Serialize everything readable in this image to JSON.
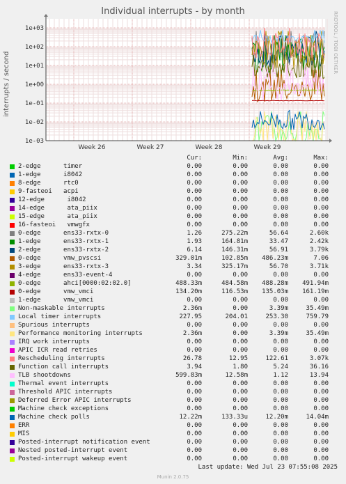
{
  "chart_data": {
    "type": "line",
    "title": "Individual interrupts - by month",
    "ylabel": "interrupts / second",
    "yscale": "log",
    "ylim": [
      0.001,
      1000
    ],
    "y_ticks": [
      "1e+03",
      "1e+02",
      "1e+01",
      "1e+00",
      "1e-01",
      "1e-02",
      "1e-03"
    ],
    "x_ticks": [
      "Week 26",
      "Week 27",
      "Week 28",
      "Week 29"
    ],
    "grid": true,
    "side_label": "RRDTOOL / TOBI OETIKER",
    "columns": [
      "Cur:",
      "Min:",
      "Avg:",
      "Max:"
    ],
    "series": [
      {
        "name": "2-edge      timer",
        "color": "#00cc00",
        "cur": "0.00",
        "min": "0.00",
        "avg": "0.00",
        "max": "0.00"
      },
      {
        "name": "1-edge      i8042",
        "color": "#0066b3",
        "cur": "0.00",
        "min": "0.00",
        "avg": "0.00",
        "max": "0.00"
      },
      {
        "name": "8-edge      rtc0",
        "color": "#ff8000",
        "cur": "0.00",
        "min": "0.00",
        "avg": "0.00",
        "max": "0.00"
      },
      {
        "name": "9-fasteoi   acpi",
        "color": "#ffcc00",
        "cur": "0.00",
        "min": "0.00",
        "avg": "0.00",
        "max": "0.00"
      },
      {
        "name": "12-edge      i8042",
        "color": "#330099",
        "cur": "0.00",
        "min": "0.00",
        "avg": "0.00",
        "max": "0.00"
      },
      {
        "name": "14-edge      ata_piix",
        "color": "#990099",
        "cur": "0.00",
        "min": "0.00",
        "avg": "0.00",
        "max": "0.00"
      },
      {
        "name": "15-edge      ata_piix",
        "color": "#ccff00",
        "cur": "0.00",
        "min": "0.00",
        "avg": "0.00",
        "max": "0.00"
      },
      {
        "name": "16-fasteoi   vmwgfx",
        "color": "#ff0000",
        "cur": "0.00",
        "min": "0.00",
        "avg": "0.00",
        "max": "0.00"
      },
      {
        "name": "0-edge      ens33-rxtx-0",
        "color": "#808080",
        "cur": "1.26",
        "min": "275.22m",
        "avg": "56.64",
        "max": "2.60k"
      },
      {
        "name": "1-edge      ens33-rxtx-1",
        "color": "#008f00",
        "cur": "1.93",
        "min": "164.81m",
        "avg": "33.47",
        "max": "2.42k"
      },
      {
        "name": "2-edge      ens33-rxtx-2",
        "color": "#00487d",
        "cur": "6.14",
        "min": "146.31m",
        "avg": "56.91",
        "max": "3.79k"
      },
      {
        "name": "0-edge      vmw_pvscsi",
        "color": "#b35a00",
        "cur": "329.01m",
        "min": "102.85m",
        "avg": "486.23m",
        "max": "7.06"
      },
      {
        "name": "3-edge      ens33-rxtx-3",
        "color": "#b38f00",
        "cur": "3.34",
        "min": "325.17m",
        "avg": "56.70",
        "max": "3.71k"
      },
      {
        "name": "4-edge      ens33-event-4",
        "color": "#6b006b",
        "cur": "0.00",
        "min": "0.00",
        "avg": "0.00",
        "max": "0.00"
      },
      {
        "name": "0-edge      ahci[0000:02:02.0]",
        "color": "#8fb300",
        "cur": "488.33m",
        "min": "484.58m",
        "avg": "488.28m",
        "max": "491.94m"
      },
      {
        "name": "0-edge      vmw_vmci",
        "color": "#b30000",
        "cur": "134.20m",
        "min": "116.53m",
        "avg": "135.03m",
        "max": "161.19m"
      },
      {
        "name": "1-edge      vmw_vmci",
        "color": "#bebebe",
        "cur": "0.00",
        "min": "0.00",
        "avg": "0.00",
        "max": "0.00"
      },
      {
        "name": "Non-maskable interrupts",
        "color": "#80ff80",
        "cur": "2.36m",
        "min": "0.00",
        "avg": "3.39m",
        "max": "35.49m"
      },
      {
        "name": "Local timer interrupts",
        "color": "#80c9ff",
        "cur": "227.95",
        "min": "204.01",
        "avg": "253.30",
        "max": "759.79"
      },
      {
        "name": "Spurious interrupts",
        "color": "#ffc080",
        "cur": "0.00",
        "min": "0.00",
        "avg": "0.00",
        "max": "0.00"
      },
      {
        "name": "Performance monitoring interrupts",
        "color": "#ffe680",
        "cur": "2.36m",
        "min": "0.00",
        "avg": "3.39m",
        "max": "35.49m"
      },
      {
        "name": "IRQ work interrupts",
        "color": "#aa80ff",
        "cur": "0.00",
        "min": "0.00",
        "avg": "0.00",
        "max": "0.00"
      },
      {
        "name": "APIC ICR read retries",
        "color": "#ee00cc",
        "cur": "0.00",
        "min": "0.00",
        "avg": "0.00",
        "max": "0.00"
      },
      {
        "name": "Rescheduling interrupts",
        "color": "#ff8080",
        "cur": "26.78",
        "min": "12.95",
        "avg": "122.61",
        "max": "3.07k"
      },
      {
        "name": "Function call interrupts",
        "color": "#666600",
        "cur": "3.94",
        "min": "1.80",
        "avg": "5.24",
        "max": "36.16"
      },
      {
        "name": "TLB shootdowns",
        "color": "#ffbfff",
        "cur": "599.83m",
        "min": "12.58m",
        "avg": "1.12",
        "max": "13.94"
      },
      {
        "name": "Thermal event interrupts",
        "color": "#00ffcc",
        "cur": "0.00",
        "min": "0.00",
        "avg": "0.00",
        "max": "0.00"
      },
      {
        "name": "Threshold APIC interrupts",
        "color": "#cc6699",
        "cur": "0.00",
        "min": "0.00",
        "avg": "0.00",
        "max": "0.00"
      },
      {
        "name": "Deferred Error APIC interrupts",
        "color": "#999900",
        "cur": "0.00",
        "min": "0.00",
        "avg": "0.00",
        "max": "0.00"
      },
      {
        "name": "Machine check exceptions",
        "color": "#00cc00",
        "cur": "0.00",
        "min": "0.00",
        "avg": "0.00",
        "max": "0.00"
      },
      {
        "name": "Machine check polls",
        "color": "#0066b3",
        "cur": "12.22m",
        "min": "133.33u",
        "avg": "12.20m",
        "max": "14.04m"
      },
      {
        "name": "ERR",
        "color": "#ff8000",
        "cur": "0.00",
        "min": "0.00",
        "avg": "0.00",
        "max": "0.00"
      },
      {
        "name": "MIS",
        "color": "#ffcc00",
        "cur": "0.00",
        "min": "0.00",
        "avg": "0.00",
        "max": "0.00"
      },
      {
        "name": "Posted-interrupt notification event",
        "color": "#330099",
        "cur": "0.00",
        "min": "0.00",
        "avg": "0.00",
        "max": "0.00"
      },
      {
        "name": "Nested posted-interrupt event",
        "color": "#990099",
        "cur": "0.00",
        "min": "0.00",
        "avg": "0.00",
        "max": "0.00"
      },
      {
        "name": "Posted-interrupt wakeup event",
        "color": "#ccff00",
        "cur": "0.00",
        "min": "0.00",
        "avg": "0.00",
        "max": "0.00"
      }
    ]
  },
  "last_update": "Last update: Wed Jul 23 07:55:08 2025",
  "footer": "Munin 2.0.75"
}
